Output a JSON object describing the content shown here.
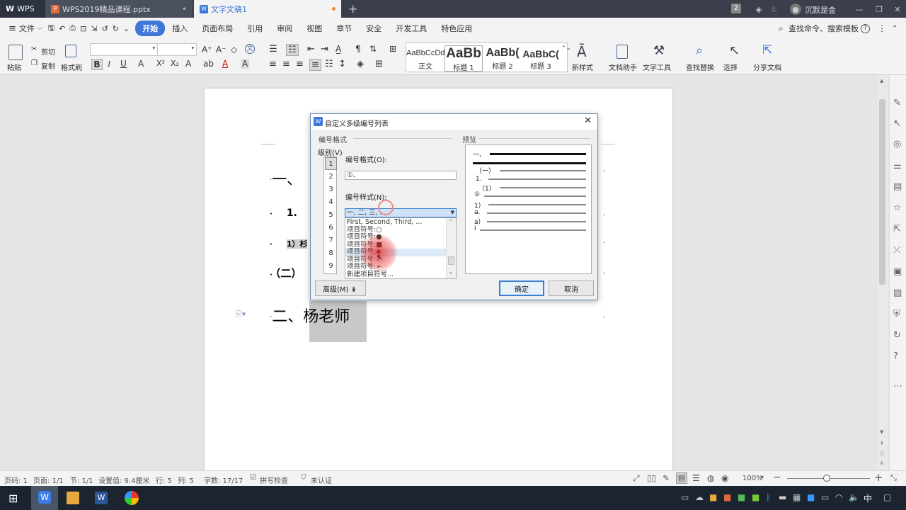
{
  "titlebar": {
    "app": "WPS",
    "tabs": [
      {
        "label": "WPS2019精品课程.pptx"
      },
      {
        "label": "文字文稿1"
      }
    ],
    "window_num": "2",
    "user": "沉默是金"
  },
  "menu": {
    "file": "文件",
    "items": [
      "开始",
      "插入",
      "页面布局",
      "引用",
      "审阅",
      "视图",
      "章节",
      "安全",
      "开发工具",
      "特色应用"
    ],
    "search": "查找命令、搜索模板"
  },
  "ribbon": {
    "paste": "粘贴",
    "cut": "剪切",
    "copy": "复制",
    "format_painter": "格式刷",
    "styles": [
      {
        "sample": "AaBbCcDd",
        "label": "正文"
      },
      {
        "sample": "AaBb",
        "label": "标题 1"
      },
      {
        "sample": "AaBb(",
        "label": "标题 2"
      },
      {
        "sample": "AaBbC(",
        "label": "标题 3"
      }
    ],
    "new_style": "新样式",
    "doc_helper": "文档助手",
    "text_tools": "文字工具",
    "find_replace": "查找替换",
    "select": "选择",
    "share": "分享文档"
  },
  "document": {
    "lines": [
      {
        "text": "一、"
      },
      {
        "text": "1."
      },
      {
        "text": "1）杉"
      },
      {
        "text": "（二）"
      },
      {
        "text": "二、杨老师"
      }
    ]
  },
  "dialog": {
    "title": "自定义多级编号列表",
    "group_format": "编号格式",
    "level_label": "级别(V)",
    "levels": [
      "1",
      "2",
      "3",
      "4",
      "5",
      "6",
      "7",
      "8",
      "9"
    ],
    "format_label": "编号格式(O):",
    "format_value": "①、",
    "style_label": "编号样式(N):",
    "style_selected": "一, 二, 三, ...",
    "style_options": [
      "First, Second, Third, ...",
      "项目符号:○",
      "项目符号:●",
      "项目符号:■",
      "项目符号:◆",
      "项目符号:✓",
      "项目符号:➢",
      "新建项目符号..."
    ],
    "preview_label": "预览",
    "preview_items": [
      "一、",
      "（一）",
      "1.",
      "（1）",
      "①",
      "1）",
      "a.",
      "a）",
      "i"
    ],
    "advanced": "高级(M) ⇟",
    "ok": "确定",
    "cancel": "取消"
  },
  "statusbar": {
    "page_no": "页码: 1",
    "pages": "页面: 1/1",
    "section": "节: 1/1",
    "setting": "设置值: 9.4厘米",
    "row": "行: 5",
    "col": "列: 5",
    "words": "字数: 17/17",
    "spell": "拼写检查",
    "auth": "未认证",
    "zoom": "100%"
  },
  "taskbar": {
    "ime": "中",
    "wps_icon": "W"
  }
}
